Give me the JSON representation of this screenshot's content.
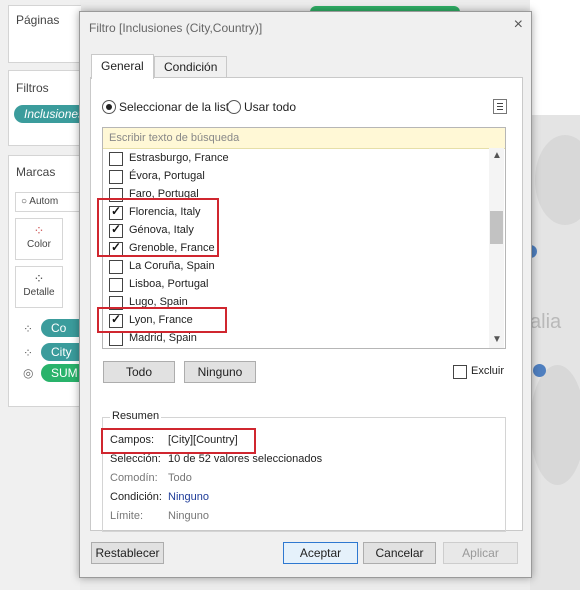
{
  "left_panel": {
    "pages_title": "Páginas",
    "filters_title": "Filtros",
    "filter_pill": "Inclusiones",
    "marks_title": "Marcas",
    "marks_type": "Autom",
    "color_label": "Color",
    "detail_label": "Detalle",
    "pills": [
      "Co",
      "City",
      "SUM"
    ]
  },
  "map": {
    "label": "alia"
  },
  "dialog": {
    "title": "Filtro [Inclusiones (City,Country)]",
    "close": "×",
    "tabs": [
      "General",
      "Condición"
    ],
    "radio_list": "Seleccionar de la lista",
    "radio_all": "Usar todo",
    "search_placeholder": "Escribir texto de búsqueda",
    "items": [
      {
        "label": "Estrasburgo, France",
        "checked": false
      },
      {
        "label": "Évora, Portugal",
        "checked": false
      },
      {
        "label": "Faro, Portugal",
        "checked": false
      },
      {
        "label": "Florencia, Italy",
        "checked": true
      },
      {
        "label": "Génova, Italy",
        "checked": true
      },
      {
        "label": "Grenoble, France",
        "checked": true
      },
      {
        "label": "La Coruña, Spain",
        "checked": false
      },
      {
        "label": "Lisboa, Portugal",
        "checked": false
      },
      {
        "label": "Lugo, Spain",
        "checked": false
      },
      {
        "label": "Lyon, France",
        "checked": true
      },
      {
        "label": "Madrid, Spain",
        "checked": false
      }
    ],
    "btn_all": "Todo",
    "btn_none": "Ninguno",
    "exclude_label": "Excluir",
    "summary": {
      "title": "Resumen",
      "fields_k": "Campos:",
      "fields_v": "[City][Country]",
      "selection_k": "Selección:",
      "selection_v": "10 de 52 valores seleccionados",
      "wildcard_k": "Comodín:",
      "wildcard_v": "Todo",
      "condition_k": "Condición:",
      "condition_v": "Ninguno",
      "limit_k": "Límite:",
      "limit_v": "Ninguno"
    },
    "footer": {
      "reset": "Restablecer",
      "ok": "Aceptar",
      "cancel": "Cancelar",
      "apply": "Aplicar"
    }
  },
  "colors": {
    "highlight": "#d0262f",
    "pill_teal": "#3b9c9c",
    "pill_green": "#29b36b",
    "link_blue": "#1f3c99"
  }
}
